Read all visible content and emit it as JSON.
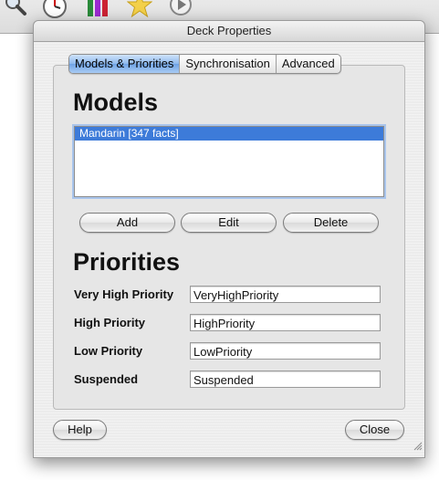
{
  "background_toolbar": {
    "icons": [
      "search-icon",
      "clock-icon",
      "chart-icon",
      "star-icon",
      "play-icon"
    ]
  },
  "dialog": {
    "title": "Deck Properties",
    "tabs": [
      {
        "label": "Models & Priorities",
        "active": true
      },
      {
        "label": "Synchronisation",
        "active": false
      },
      {
        "label": "Advanced",
        "active": false
      }
    ],
    "models_heading": "Models",
    "models": [
      {
        "label": "Mandarin [347 facts]",
        "selected": true
      }
    ],
    "model_buttons": {
      "add": "Add",
      "edit": "Edit",
      "delete": "Delete"
    },
    "priorities_heading": "Priorities",
    "priorities": [
      {
        "label": "Very High Priority",
        "value": "VeryHighPriority"
      },
      {
        "label": "High Priority",
        "value": "HighPriority"
      },
      {
        "label": "Low Priority",
        "value": "LowPriority"
      },
      {
        "label": "Suspended",
        "value": "Suspended"
      }
    ],
    "footer": {
      "help": "Help",
      "close": "Close"
    }
  },
  "colors": {
    "selection": "#3d7bd9",
    "active_tab": "#6fa3e4",
    "dialog_bg": "#ececec"
  }
}
